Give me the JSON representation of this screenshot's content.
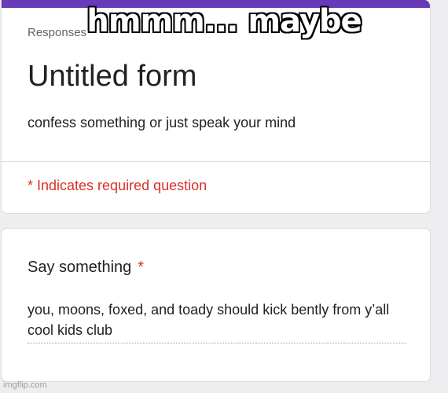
{
  "meme": {
    "caption": "hmmm... maybe"
  },
  "form": {
    "tab": "Responses",
    "title": "Untitled form",
    "description": "confess something or just speak your mind",
    "required_note": "* Indicates required question"
  },
  "question": {
    "title": "Say something",
    "required_star": "*",
    "answer": "you, moons, foxed, and toady should kick bently from y’all cool kids club"
  },
  "watermark": "imgflip.com",
  "colors": {
    "accent": "#673ab7",
    "required": "#d93025",
    "background": "#eeeef0"
  }
}
